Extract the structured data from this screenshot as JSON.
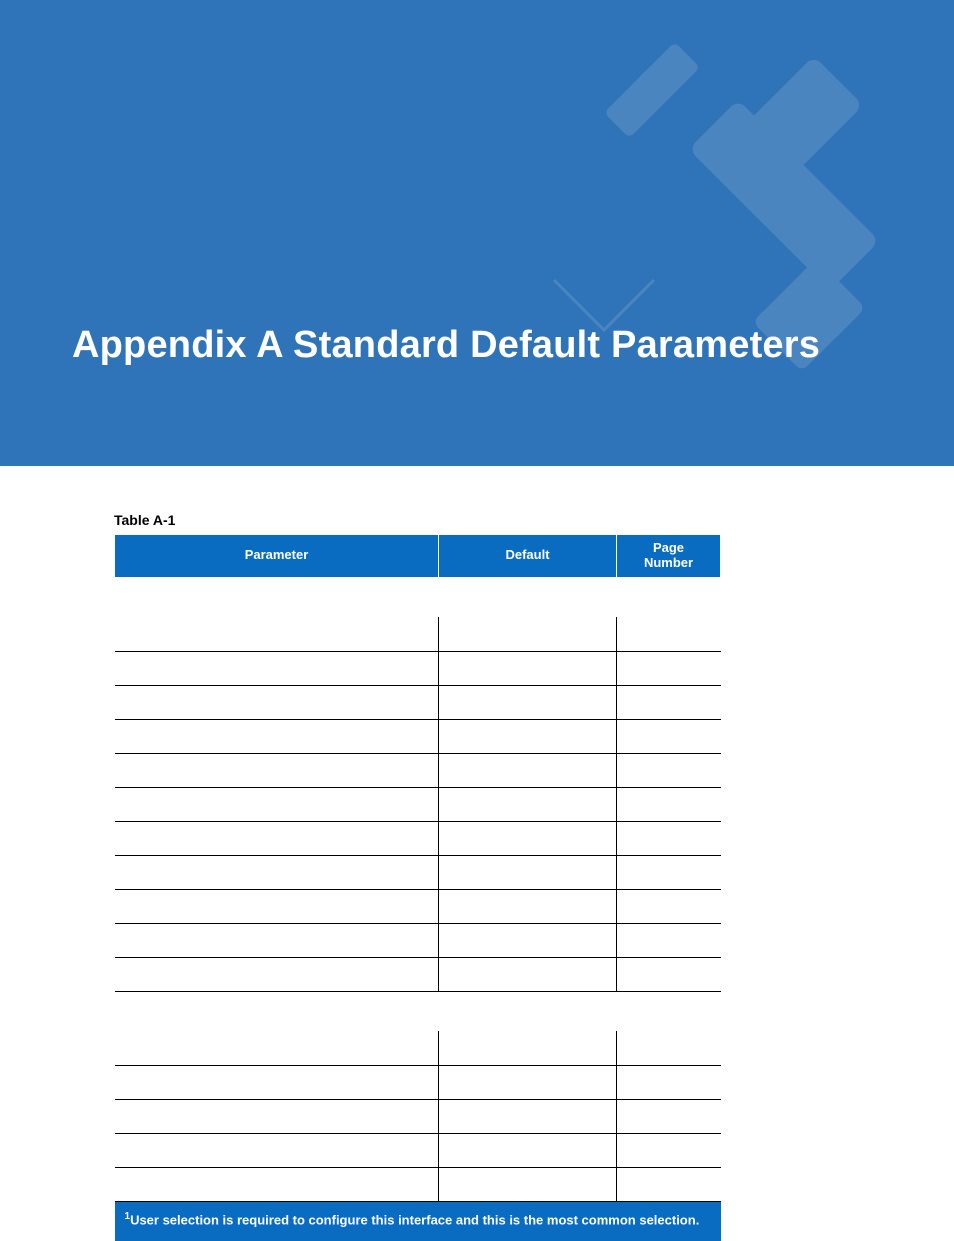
{
  "header": {
    "title": "Appendix A  Standard Default Parameters"
  },
  "table": {
    "caption": "Table A-1",
    "columns": {
      "parameter": "Parameter",
      "default": "Default",
      "page": "Page\nNumber"
    },
    "footnote_sup": "1",
    "footnote": "User selection is required to configure this interface and this is the most common selection."
  }
}
